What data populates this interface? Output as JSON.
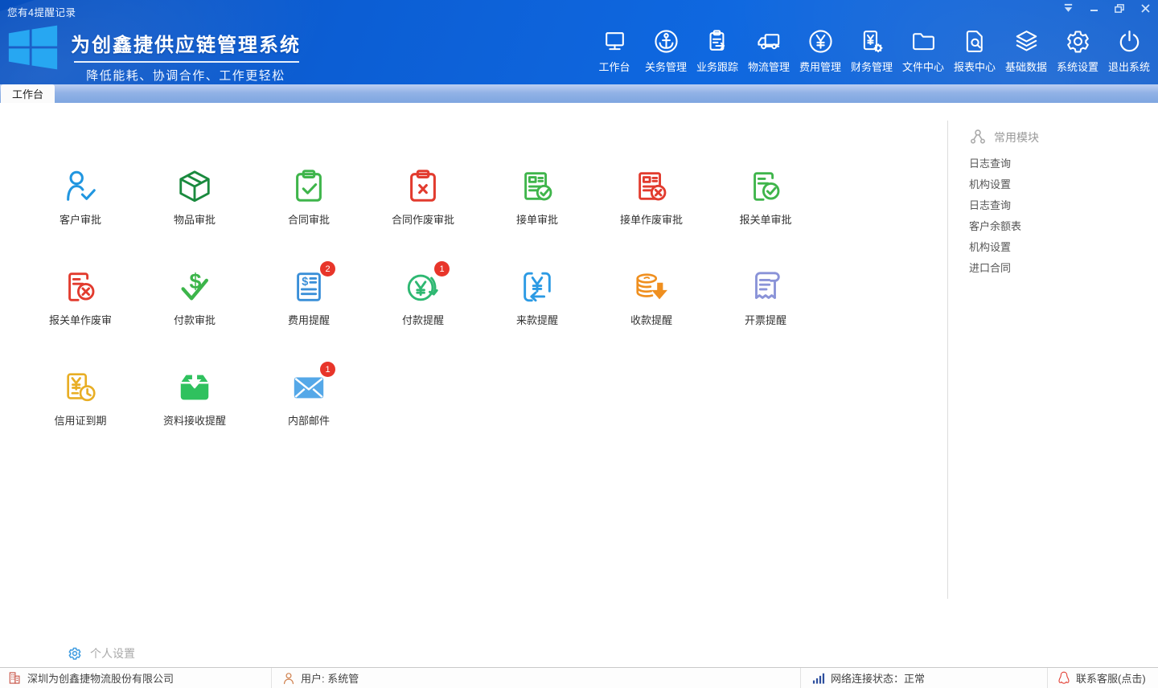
{
  "window": {
    "notice": "您有4提醒记录",
    "controls": {
      "skin": "skin-menu",
      "minimize": "minimize",
      "restore": "restore",
      "close": "close"
    }
  },
  "header": {
    "title": "为创鑫捷供应链管理系统",
    "subtitle": "降低能耗、协调合作、工作更轻松"
  },
  "nav": {
    "items": [
      {
        "label": "工作台",
        "icon": "monitor-icon"
      },
      {
        "label": "关务管理",
        "icon": "anchor-icon"
      },
      {
        "label": "业务跟踪",
        "icon": "clipboard-arrow-icon"
      },
      {
        "label": "物流管理",
        "icon": "truck-icon"
      },
      {
        "label": "费用管理",
        "icon": "yen-circle-icon"
      },
      {
        "label": "财务管理",
        "icon": "finance-doc-icon"
      },
      {
        "label": "文件中心",
        "icon": "folder-icon"
      },
      {
        "label": "报表中心",
        "icon": "report-search-icon"
      },
      {
        "label": "基础数据",
        "icon": "layers-icon"
      },
      {
        "label": "系统设置",
        "icon": "gear-icon"
      },
      {
        "label": "退出系统",
        "icon": "power-icon"
      }
    ]
  },
  "tabs": {
    "active": "工作台"
  },
  "modules": {
    "items": [
      {
        "label": "客户审批",
        "icon": "person-check-icon",
        "color": "#2196e0"
      },
      {
        "label": "物品审批",
        "icon": "box-icon",
        "color": "#1a8a3e"
      },
      {
        "label": "合同审批",
        "icon": "clipboard-check-icon",
        "color": "#3fb54b"
      },
      {
        "label": "合同作废审批",
        "icon": "clipboard-x-icon",
        "color": "#e23b2e"
      },
      {
        "label": "接单审批",
        "icon": "form-check-icon",
        "color": "#3fb54b"
      },
      {
        "label": "接单作废审批",
        "icon": "form-x-icon",
        "color": "#e23b2e"
      },
      {
        "label": "报关单审批",
        "icon": "doc-check-icon",
        "color": "#3fb54b"
      },
      {
        "label": "报关单作废审",
        "icon": "doc-x-icon",
        "color": "#e23b2e"
      },
      {
        "label": "付款审批",
        "icon": "dollar-check-icon",
        "color": "#3cb54a"
      },
      {
        "label": "费用提醒",
        "icon": "fee-doc-icon",
        "color": "#3a8fd8",
        "badge": "2"
      },
      {
        "label": "付款提醒",
        "icon": "yen-arrow-icon",
        "color": "#2eb872",
        "badge": "1"
      },
      {
        "label": "来款提醒",
        "icon": "incoming-yen-icon",
        "color": "#2b9ae4"
      },
      {
        "label": "收款提醒",
        "icon": "coins-arrow-icon",
        "color": "#ef8f1f"
      },
      {
        "label": "开票提醒",
        "icon": "receipt-icon",
        "color": "#8a93d8"
      },
      {
        "label": "信用证到期",
        "icon": "credit-clock-icon",
        "color": "#e8ae25"
      },
      {
        "label": "资料接收提醒",
        "icon": "inbox-receive-icon",
        "color": "#2fc15e"
      },
      {
        "label": "内部邮件",
        "icon": "mail-icon",
        "color": "#55a8e8",
        "badge": "1"
      }
    ]
  },
  "sidebar": {
    "title": "常用模块",
    "items": [
      "日志查询",
      "机构设置",
      "日志查询",
      "客户余额表",
      "机构设置",
      "进口合同"
    ]
  },
  "personal_settings": {
    "label": "个人设置"
  },
  "statusbar": {
    "company": "深圳为创鑫捷物流股份有限公司",
    "user": "用户: 系统管",
    "network": "网络连接状态：正常",
    "support": "联系客服(点击)"
  },
  "colors": {
    "header_blue": "#0d62d8",
    "tabstrip_blue": "#8fb0e4",
    "badge_red": "#e8352a",
    "logo_tile_blue": "#27a7f2",
    "active_tab_bg": "#fbfbfb"
  }
}
